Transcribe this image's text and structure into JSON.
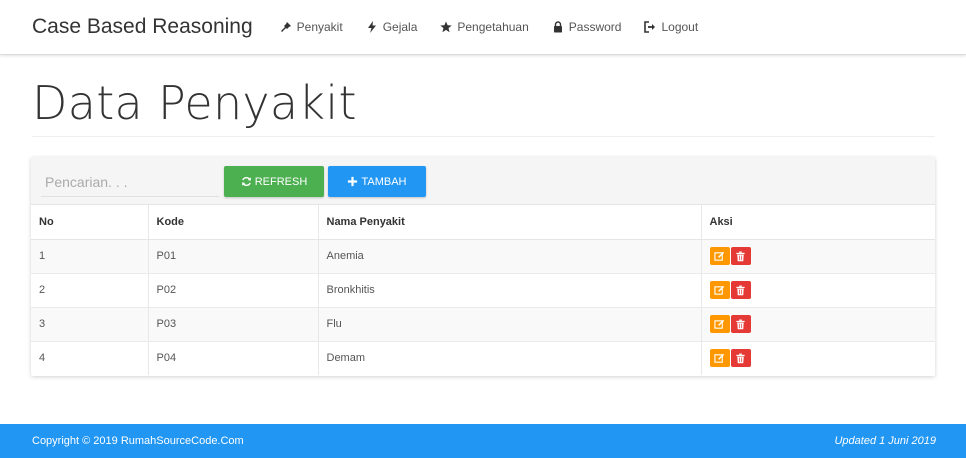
{
  "navbar": {
    "brand": "Case Based Reasoning",
    "items": [
      {
        "label": "Penyakit",
        "icon": "pushpin-icon"
      },
      {
        "label": "Gejala",
        "icon": "flash-icon"
      },
      {
        "label": "Pengetahuan",
        "icon": "star-icon"
      },
      {
        "label": "Password",
        "icon": "lock-icon"
      },
      {
        "label": "Logout",
        "icon": "logout-icon"
      }
    ]
  },
  "page": {
    "title": "Data Penyakit"
  },
  "toolbar": {
    "search_placeholder": "Pencarian. . .",
    "refresh_label": "REFRESH",
    "add_label": "TAMBAH"
  },
  "table": {
    "headers": [
      "No",
      "Kode",
      "Nama Penyakit",
      "Aksi"
    ],
    "rows": [
      {
        "no": "1",
        "kode": "P01",
        "nama": "Anemia"
      },
      {
        "no": "2",
        "kode": "P02",
        "nama": "Bronkhitis"
      },
      {
        "no": "3",
        "kode": "P03",
        "nama": "Flu"
      },
      {
        "no": "4",
        "kode": "P04",
        "nama": "Demam"
      }
    ]
  },
  "footer": {
    "copyright": "Copyright © 2019 RumahSourceCode.Com",
    "updated": "Updated 1 Juni 2019"
  },
  "colors": {
    "primary": "#2196f3",
    "success": "#4caf50",
    "warning": "#ff9800",
    "danger": "#e53935"
  }
}
